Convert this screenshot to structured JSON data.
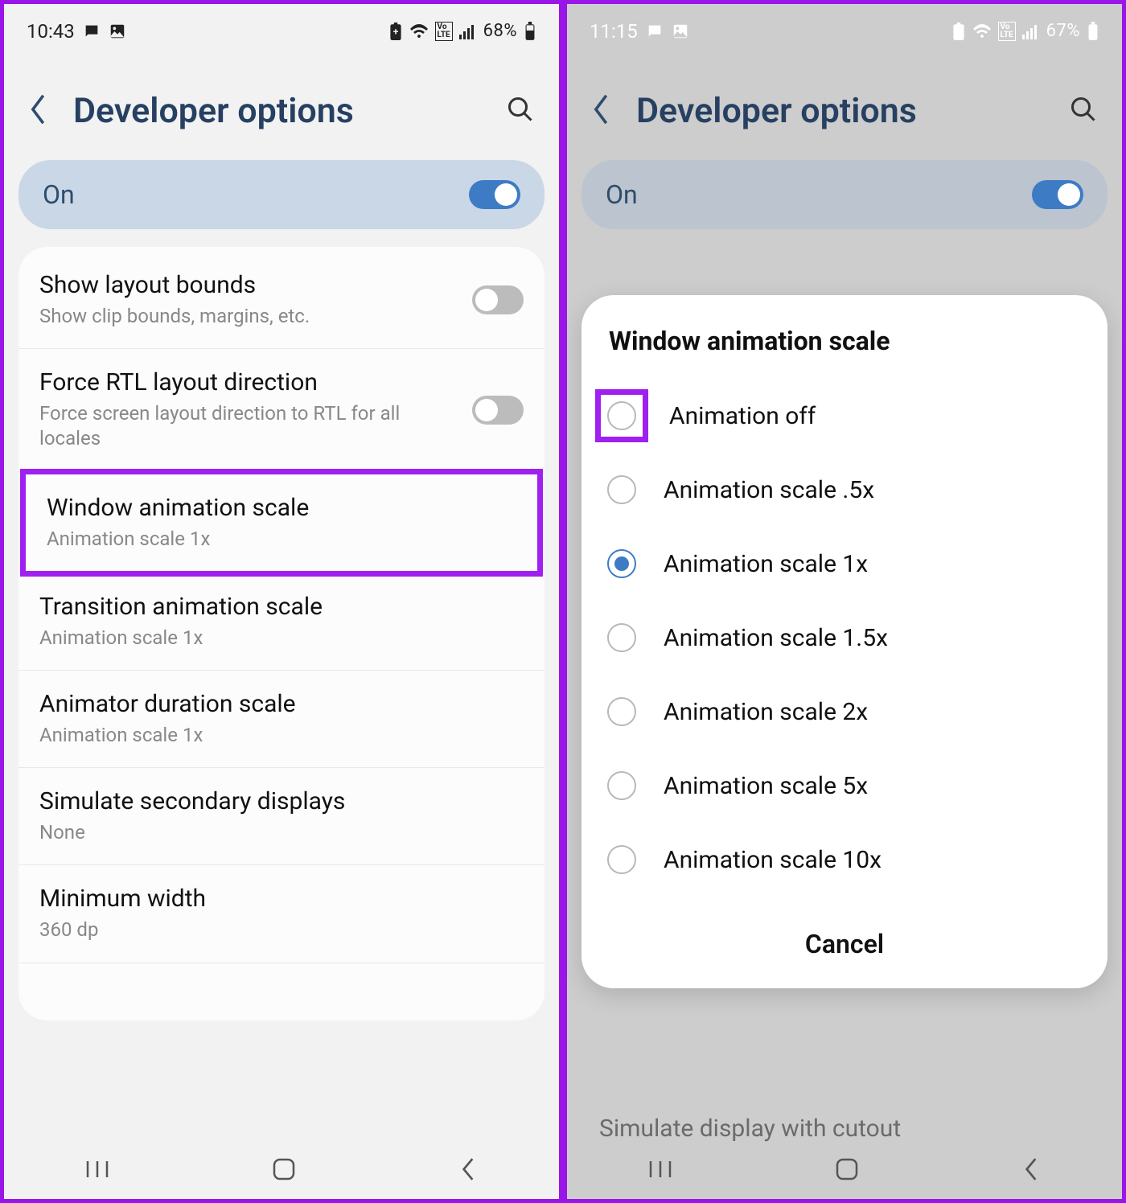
{
  "left": {
    "status": {
      "time": "10:43",
      "battery": "68%"
    },
    "header": {
      "title": "Developer options"
    },
    "on_row": {
      "label": "On"
    },
    "rows": [
      {
        "title": "Show layout bounds",
        "sub": "Show clip bounds, margins, etc.",
        "toggle": "off"
      },
      {
        "title": "Force RTL layout direction",
        "sub": "Force screen layout direction to RTL for all locales",
        "toggle": "off"
      },
      {
        "title": "Window animation scale",
        "sub": "Animation scale 1x",
        "highlight": true
      },
      {
        "title": "Transition animation scale",
        "sub": "Animation scale 1x"
      },
      {
        "title": "Animator duration scale",
        "sub": "Animation scale 1x"
      },
      {
        "title": "Simulate secondary displays",
        "sub": "None"
      },
      {
        "title": "Minimum width",
        "sub": "360 dp"
      }
    ],
    "cutoff_hint": ""
  },
  "right": {
    "status": {
      "time": "11:15",
      "battery": "67%"
    },
    "header": {
      "title": "Developer options"
    },
    "on_row": {
      "label": "On"
    },
    "behind_text": "Simulate display with cutout",
    "dialog": {
      "title": "Window animation scale",
      "options": [
        {
          "label": "Animation off",
          "selected": false,
          "highlight": true
        },
        {
          "label": "Animation scale .5x",
          "selected": false
        },
        {
          "label": "Animation scale 1x",
          "selected": true
        },
        {
          "label": "Animation scale 1.5x",
          "selected": false
        },
        {
          "label": "Animation scale 2x",
          "selected": false
        },
        {
          "label": "Animation scale 5x",
          "selected": false
        },
        {
          "label": "Animation scale 10x",
          "selected": false
        }
      ],
      "cancel": "Cancel"
    }
  }
}
